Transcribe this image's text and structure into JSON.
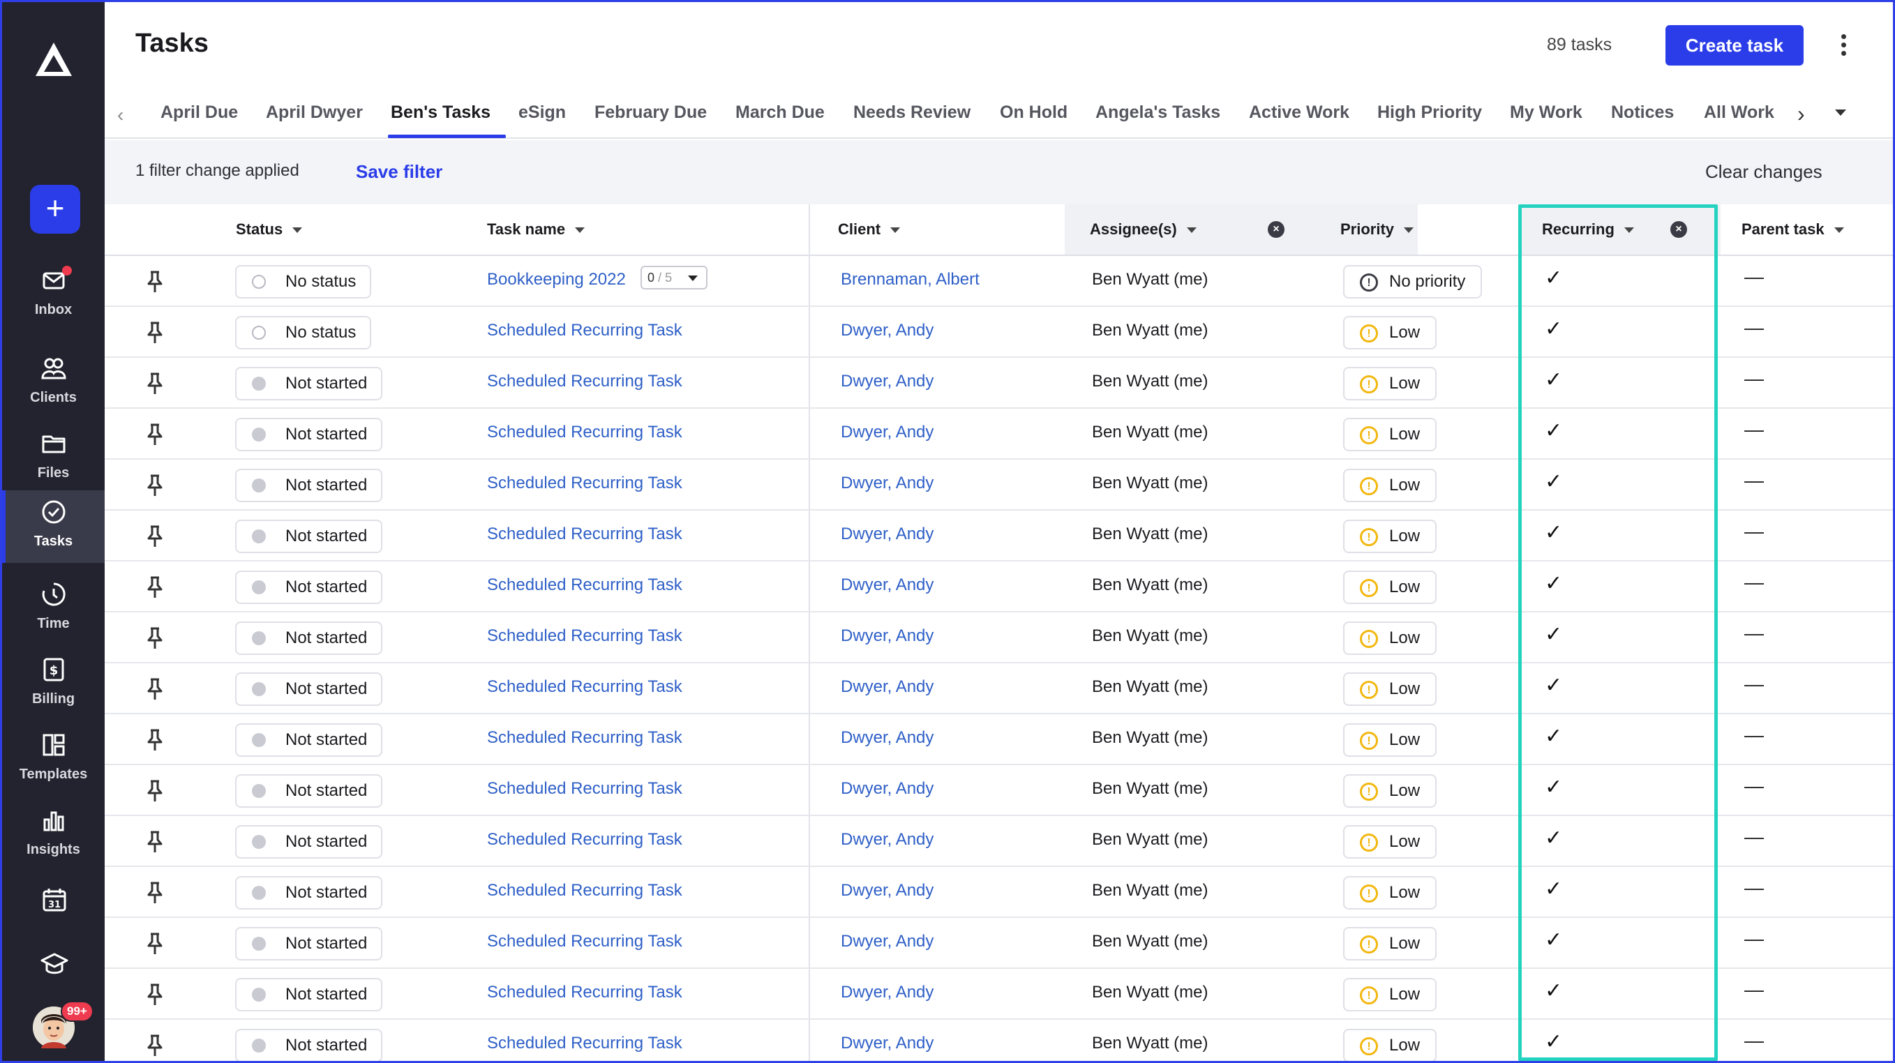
{
  "header": {
    "title": "Tasks",
    "task_count": "89 tasks",
    "create_label": "Create task"
  },
  "sidebar": {
    "add_symbol": "+",
    "items": [
      {
        "key": "inbox",
        "label": "Inbox",
        "icon": "inbox-icon"
      },
      {
        "key": "clients",
        "label": "Clients",
        "icon": "clients-icon"
      },
      {
        "key": "files",
        "label": "Files",
        "icon": "folder-icon"
      },
      {
        "key": "tasks",
        "label": "Tasks",
        "icon": "check-circle-icon",
        "active": true
      },
      {
        "key": "time",
        "label": "Time",
        "icon": "clock-icon"
      },
      {
        "key": "billing",
        "label": "Billing",
        "icon": "billing-icon"
      },
      {
        "key": "templates",
        "label": "Templates",
        "icon": "templates-icon"
      },
      {
        "key": "insights",
        "label": "Insights",
        "icon": "bar-chart-icon"
      }
    ],
    "calendar_day": "31",
    "avatar_badge": "99+"
  },
  "tabs": [
    "April Due",
    "April Dwyer",
    "Ben's Tasks",
    "eSign",
    "February Due",
    "March Due",
    "Needs Review",
    "On Hold",
    "Angela's Tasks",
    "Active Work",
    "High Priority",
    "My Work",
    "Notices",
    "All Work"
  ],
  "active_tab": "Ben's Tasks",
  "filter": {
    "text": "1 filter change applied",
    "save_label": "Save filter",
    "clear_label": "Clear changes"
  },
  "columns": {
    "status": "Status",
    "task_name": "Task name",
    "client": "Client",
    "assignees": "Assignee(s)",
    "priority": "Priority",
    "recurring": "Recurring",
    "parent_task": "Parent task"
  },
  "rows": [
    {
      "status": "No status",
      "status_type": "empty",
      "task": "Bookkeeping 2022",
      "subtasks_done": "0",
      "subtasks_total": "5",
      "client": "Brennaman, Albert",
      "assignee": "Ben Wyatt (me)",
      "priority": "No priority",
      "priority_type": "none",
      "recurring": "✓",
      "parent": "—"
    },
    {
      "status": "No status",
      "status_type": "empty",
      "task": "Scheduled Recurring Task",
      "client": "Dwyer, Andy",
      "assignee": "Ben Wyatt (me)",
      "priority": "Low",
      "priority_type": "low",
      "recurring": "✓",
      "parent": "—"
    },
    {
      "status": "Not started",
      "status_type": "filled",
      "task": "Scheduled Recurring Task",
      "client": "Dwyer, Andy",
      "assignee": "Ben Wyatt (me)",
      "priority": "Low",
      "priority_type": "low",
      "recurring": "✓",
      "parent": "—"
    },
    {
      "status": "Not started",
      "status_type": "filled",
      "task": "Scheduled Recurring Task",
      "client": "Dwyer, Andy",
      "assignee": "Ben Wyatt (me)",
      "priority": "Low",
      "priority_type": "low",
      "recurring": "✓",
      "parent": "—"
    },
    {
      "status": "Not started",
      "status_type": "filled",
      "task": "Scheduled Recurring Task",
      "client": "Dwyer, Andy",
      "assignee": "Ben Wyatt (me)",
      "priority": "Low",
      "priority_type": "low",
      "recurring": "✓",
      "parent": "—"
    },
    {
      "status": "Not started",
      "status_type": "filled",
      "task": "Scheduled Recurring Task",
      "client": "Dwyer, Andy",
      "assignee": "Ben Wyatt (me)",
      "priority": "Low",
      "priority_type": "low",
      "recurring": "✓",
      "parent": "—"
    },
    {
      "status": "Not started",
      "status_type": "filled",
      "task": "Scheduled Recurring Task",
      "client": "Dwyer, Andy",
      "assignee": "Ben Wyatt (me)",
      "priority": "Low",
      "priority_type": "low",
      "recurring": "✓",
      "parent": "—"
    },
    {
      "status": "Not started",
      "status_type": "filled",
      "task": "Scheduled Recurring Task",
      "client": "Dwyer, Andy",
      "assignee": "Ben Wyatt (me)",
      "priority": "Low",
      "priority_type": "low",
      "recurring": "✓",
      "parent": "—"
    },
    {
      "status": "Not started",
      "status_type": "filled",
      "task": "Scheduled Recurring Task",
      "client": "Dwyer, Andy",
      "assignee": "Ben Wyatt (me)",
      "priority": "Low",
      "priority_type": "low",
      "recurring": "✓",
      "parent": "—"
    },
    {
      "status": "Not started",
      "status_type": "filled",
      "task": "Scheduled Recurring Task",
      "client": "Dwyer, Andy",
      "assignee": "Ben Wyatt (me)",
      "priority": "Low",
      "priority_type": "low",
      "recurring": "✓",
      "parent": "—"
    },
    {
      "status": "Not started",
      "status_type": "filled",
      "task": "Scheduled Recurring Task",
      "client": "Dwyer, Andy",
      "assignee": "Ben Wyatt (me)",
      "priority": "Low",
      "priority_type": "low",
      "recurring": "✓",
      "parent": "—"
    },
    {
      "status": "Not started",
      "status_type": "filled",
      "task": "Scheduled Recurring Task",
      "client": "Dwyer, Andy",
      "assignee": "Ben Wyatt (me)",
      "priority": "Low",
      "priority_type": "low",
      "recurring": "✓",
      "parent": "—"
    },
    {
      "status": "Not started",
      "status_type": "filled",
      "task": "Scheduled Recurring Task",
      "client": "Dwyer, Andy",
      "assignee": "Ben Wyatt (me)",
      "priority": "Low",
      "priority_type": "low",
      "recurring": "✓",
      "parent": "—"
    },
    {
      "status": "Not started",
      "status_type": "filled",
      "task": "Scheduled Recurring Task",
      "client": "Dwyer, Andy",
      "assignee": "Ben Wyatt (me)",
      "priority": "Low",
      "priority_type": "low",
      "recurring": "✓",
      "parent": "—"
    },
    {
      "status": "Not started",
      "status_type": "filled",
      "task": "Scheduled Recurring Task",
      "client": "Dwyer, Andy",
      "assignee": "Ben Wyatt (me)",
      "priority": "Low",
      "priority_type": "low",
      "recurring": "✓",
      "parent": "—"
    },
    {
      "status": "Not started",
      "status_type": "filled",
      "task": "Scheduled Recurring Task",
      "client": "Dwyer, Andy",
      "assignee": "Ben Wyatt (me)",
      "priority": "Low",
      "priority_type": "low",
      "recurring": "✓",
      "parent": "—"
    }
  ],
  "colors": {
    "accent": "#2b3de8",
    "sidebar_bg": "#22232e",
    "link": "#2e5fc7",
    "low_priority": "#f2b710",
    "highlight": "#23d3c0"
  }
}
